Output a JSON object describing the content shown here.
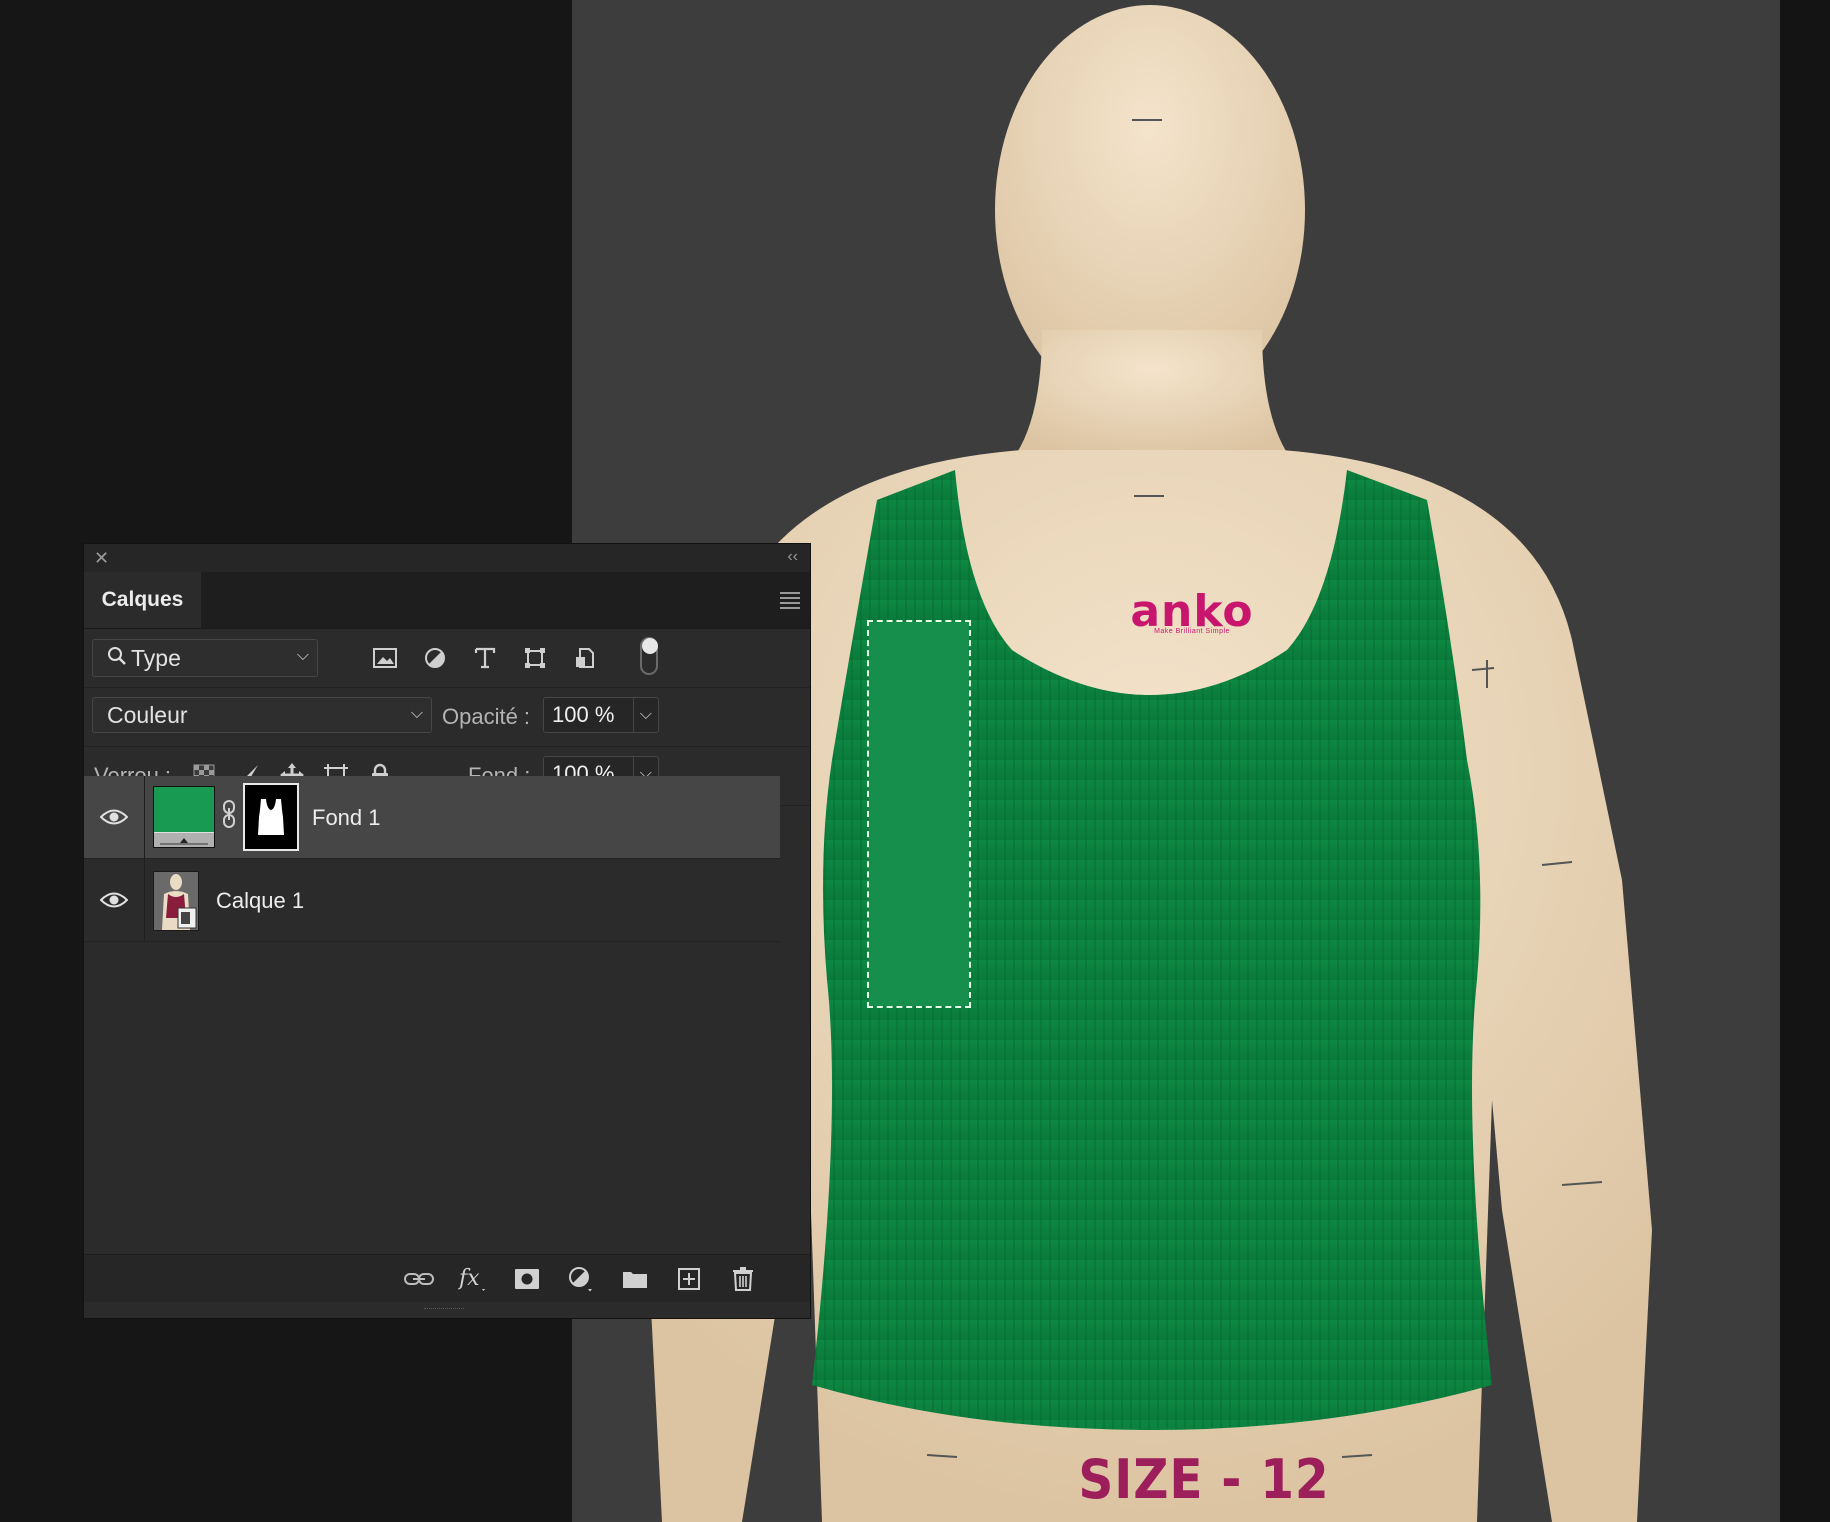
{
  "canvas": {
    "logo_text": "anko",
    "logo_tagline": "Make Brilliant Simple",
    "size_label": "SIZE - 12",
    "garment_color": "#0b7e3c",
    "selection_color": "#178f4c"
  },
  "panel": {
    "title": "Calques",
    "filter": {
      "label": "Type",
      "icons": [
        "image-filter-icon",
        "adjustment-filter-icon",
        "type-filter-icon",
        "shape-filter-icon",
        "smart-object-filter-icon"
      ]
    },
    "blend_mode": "Couleur",
    "opacity_label": "Opacité :",
    "opacity_value": "100 %",
    "lock_label": "Verrou :",
    "fill_label": "Fond :",
    "fill_value": "100 %",
    "layers": [
      {
        "name": "Fond 1",
        "type": "fill",
        "thumb_color": "#199a52",
        "selected": true,
        "visible": true
      },
      {
        "name": "Calque 1",
        "type": "smart-object",
        "selected": false,
        "visible": true
      }
    ],
    "bottom_icons": [
      "link-layers-icon",
      "fx-icon",
      "add-mask-icon",
      "adjustment-layer-icon",
      "group-folder-icon",
      "new-layer-icon",
      "trash-icon"
    ]
  }
}
